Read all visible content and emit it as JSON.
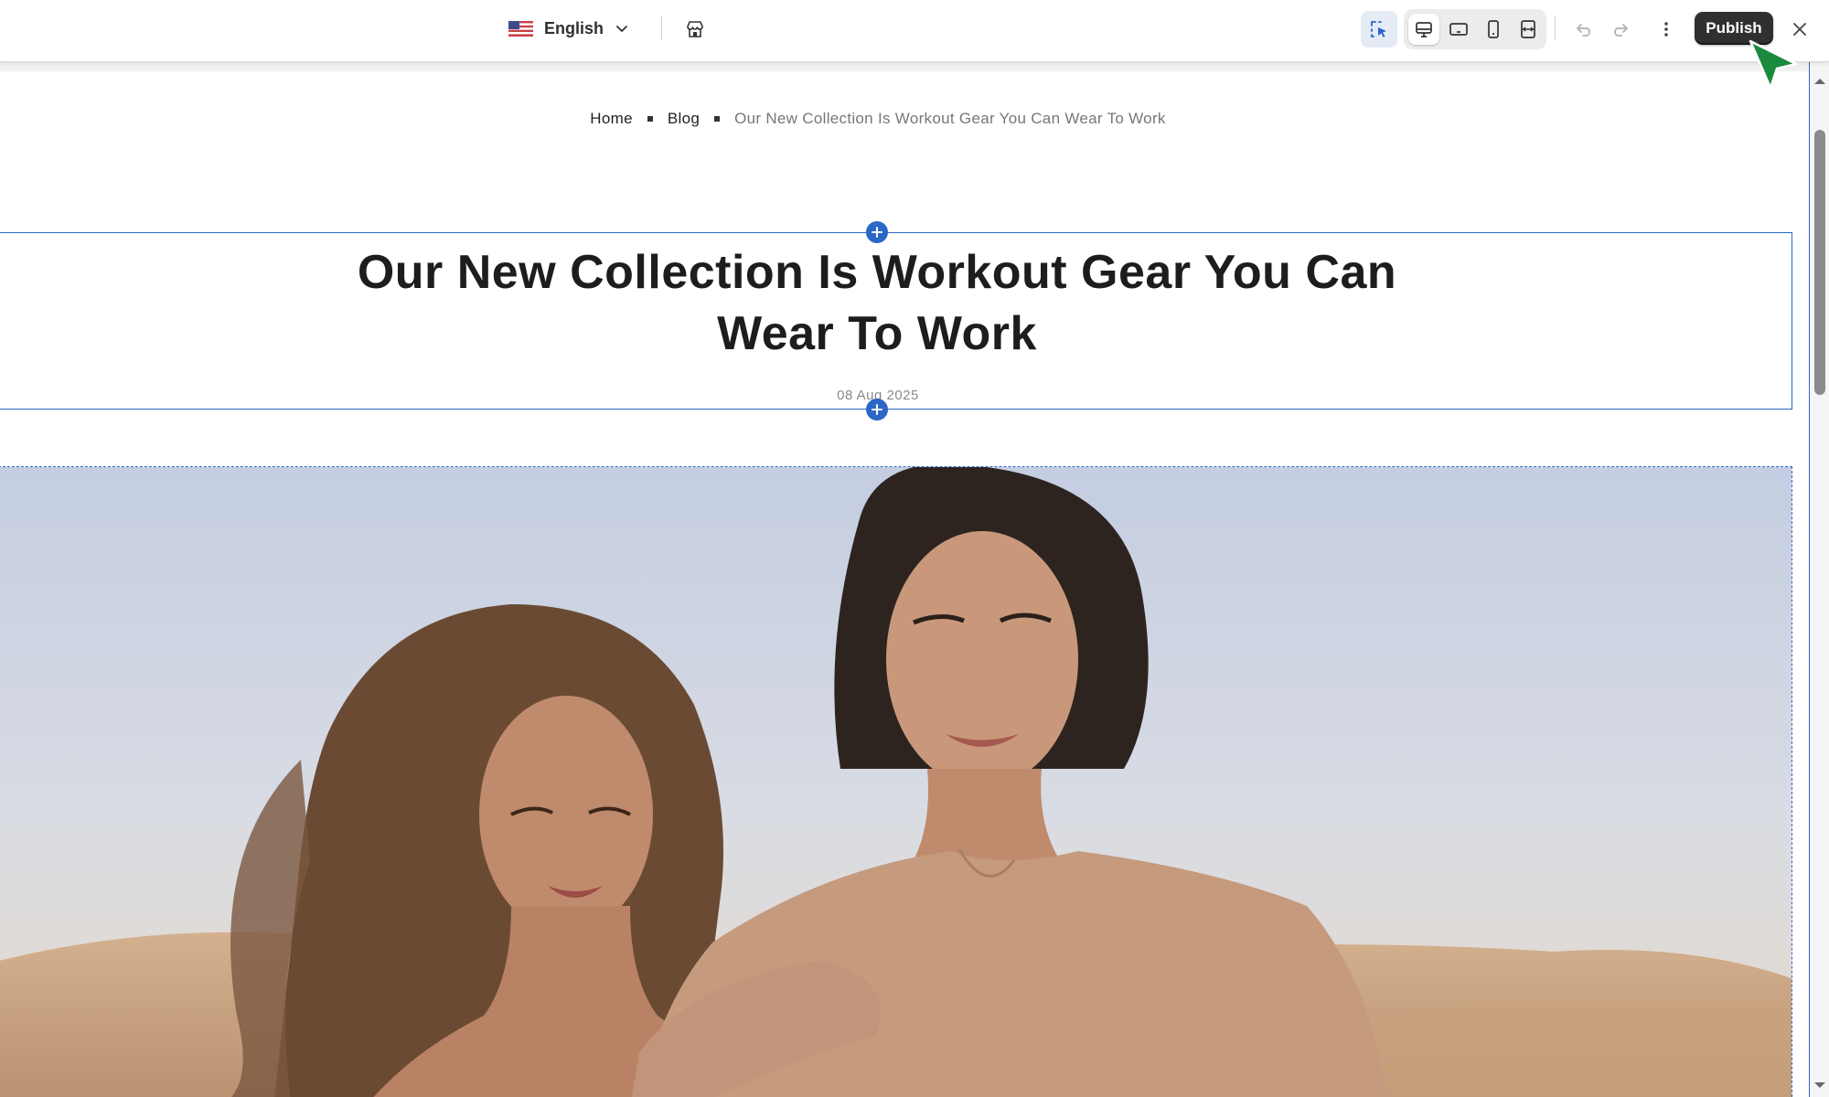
{
  "toolbar": {
    "language": "English",
    "publish_label": "Publish"
  },
  "breadcrumb": {
    "home": "Home",
    "blog": "Blog",
    "current": "Our New Collection Is Workout Gear You Can Wear To Work"
  },
  "article": {
    "title_line1": "Our New Collection Is Workout Gear You Can",
    "title_line2": "Wear To Work",
    "date": "08 Aug 2025"
  },
  "colors": {
    "accent": "#2b67c7",
    "publish_bg": "#303030",
    "cursor": "#1b8a3c"
  },
  "icons": [
    "us-flag-icon",
    "chevron-down-icon",
    "store-icon",
    "inspector-select-icon",
    "desktop-icon",
    "tablet-landscape-icon",
    "mobile-icon",
    "fullwidth-icon",
    "undo-icon",
    "redo-icon",
    "more-vertical-icon",
    "close-icon",
    "plus-icon"
  ]
}
